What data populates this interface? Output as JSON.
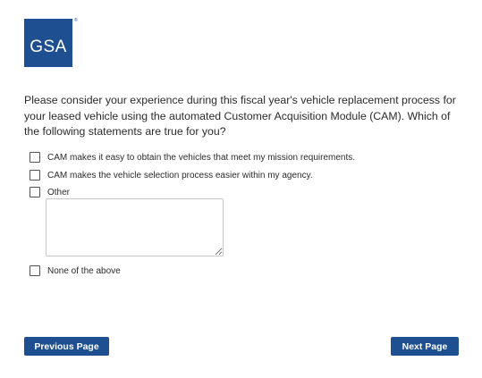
{
  "logo": {
    "text": "GSA",
    "registered": "®"
  },
  "question": {
    "text": "Please consider your experience during this fiscal year's vehicle replacement process for your leased vehicle using the automated Customer Acquisition Module (CAM). Which of the following statements are true for you?"
  },
  "options": [
    {
      "label": "CAM makes it easy to obtain the vehicles that meet my mission requirements.",
      "checked": false
    },
    {
      "label": "CAM makes the vehicle selection process easier within my agency.",
      "checked": false
    },
    {
      "label": "Other",
      "checked": false
    },
    {
      "label": "None of the above",
      "checked": false
    }
  ],
  "other_text": {
    "value": ""
  },
  "nav": {
    "previous_label": "Previous Page",
    "next_label": "Next Page"
  },
  "colors": {
    "brand": "#1e4f90",
    "text": "#2b2b2b",
    "button_text": "#ffffff"
  }
}
